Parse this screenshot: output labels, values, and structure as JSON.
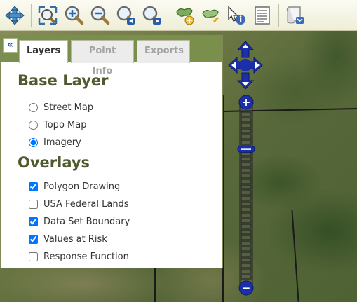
{
  "toolbar": {
    "tools": [
      {
        "name": "pan-icon"
      },
      {
        "name": "zoom-extent-icon"
      },
      {
        "name": "zoom-in-icon"
      },
      {
        "name": "zoom-out-icon"
      },
      {
        "name": "zoom-previous-icon"
      },
      {
        "name": "zoom-next-icon"
      },
      {
        "name": "add-polygon-icon"
      },
      {
        "name": "edit-polygon-icon"
      },
      {
        "name": "identify-icon"
      },
      {
        "name": "list-icon"
      },
      {
        "name": "export-map-icon"
      }
    ]
  },
  "panel": {
    "collapse_label": "«",
    "tabs": [
      {
        "label": "Layers",
        "active": true
      },
      {
        "label": "Point Info",
        "active": false
      },
      {
        "label": "Exports",
        "active": false
      }
    ],
    "base_layer": {
      "title": "Base Layer",
      "options": [
        {
          "label": "Street Map",
          "selected": false
        },
        {
          "label": "Topo Map",
          "selected": false
        },
        {
          "label": "Imagery",
          "selected": true
        }
      ]
    },
    "overlays": {
      "title": "Overlays",
      "options": [
        {
          "label": "Polygon Drawing",
          "checked": true
        },
        {
          "label": "USA Federal Lands",
          "checked": false
        },
        {
          "label": "Data Set Boundary",
          "checked": true
        },
        {
          "label": "Values at Risk",
          "checked": true
        },
        {
          "label": "Response Function",
          "checked": false
        }
      ]
    }
  },
  "map_controls": {
    "zoom_in_label": "+",
    "zoom_out_label": "−",
    "zoom_level_fraction": 0.22
  },
  "colors": {
    "accent_blue": "#1a2fa8",
    "panel_header": "#7a8f4b",
    "section_title": "#4f5b2f"
  }
}
